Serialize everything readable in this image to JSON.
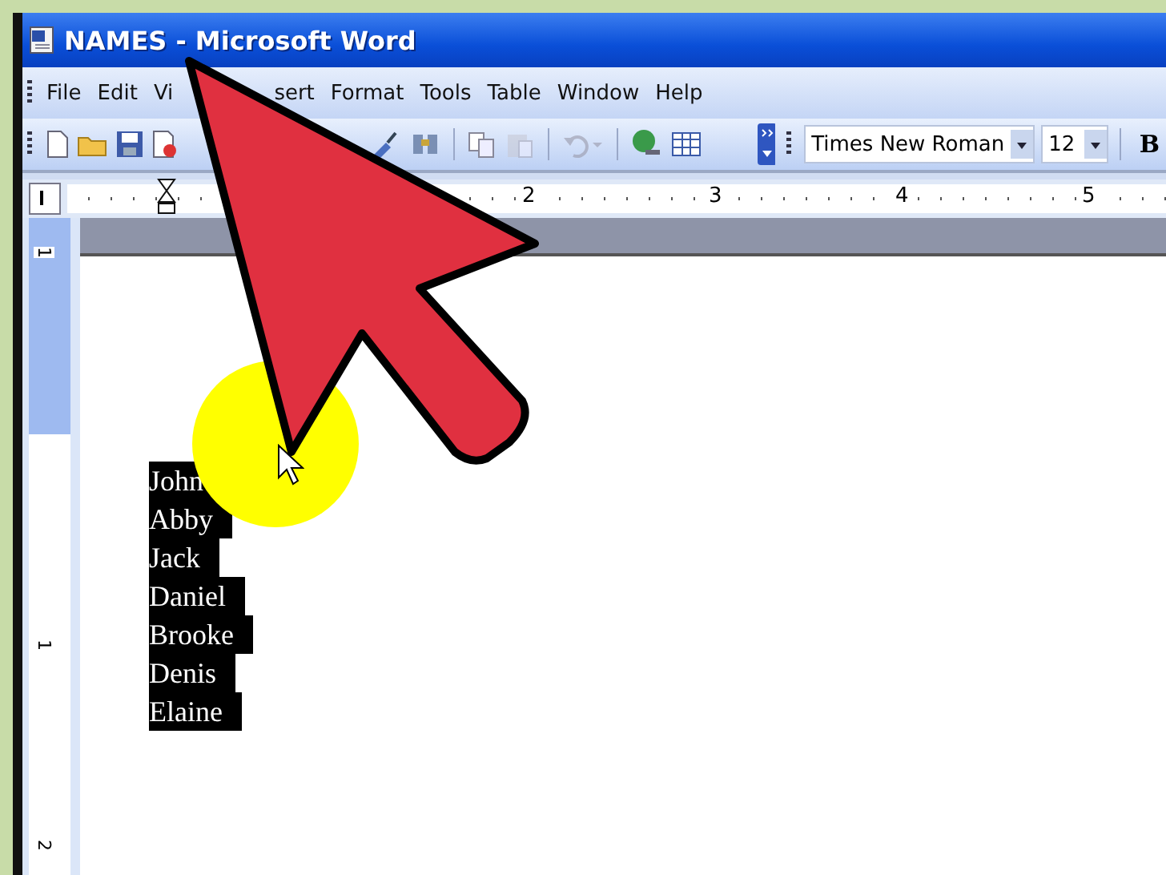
{
  "window": {
    "title": "NAMES - Microsoft Word"
  },
  "menu": [
    {
      "label": "File"
    },
    {
      "label": "Edit"
    },
    {
      "label": "Vi"
    },
    {
      "label": "sert"
    },
    {
      "label": "Format"
    },
    {
      "label": "Tools"
    },
    {
      "label": "Table"
    },
    {
      "label": "Window"
    },
    {
      "label": "Help"
    }
  ],
  "formatting": {
    "font": "Times New Roman",
    "size": "12",
    "bold": "B"
  },
  "ruler": {
    "numbers": [
      "2",
      "3",
      "4",
      "5"
    ]
  },
  "vertical_ruler": {
    "numbers": [
      "1",
      "1",
      "2"
    ]
  },
  "document": {
    "lines": [
      {
        "text": "John",
        "selected": true
      },
      {
        "text": "Abby",
        "selected": true
      },
      {
        "text": "Jack",
        "selected": true
      },
      {
        "text": "Daniel",
        "selected": true
      },
      {
        "text": "Brooke",
        "selected": true
      },
      {
        "text": "Denis",
        "selected": true
      },
      {
        "text": "Elaine",
        "selected": true
      }
    ]
  }
}
